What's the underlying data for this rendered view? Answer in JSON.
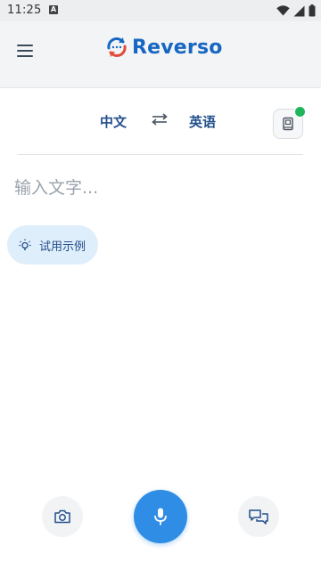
{
  "status_bar": {
    "time": "11:25",
    "notification_icon": "a-notification-icon",
    "wifi_icon": "wifi-icon",
    "signal_icon": "cellular-signal-icon",
    "battery_icon": "battery-icon"
  },
  "app_bar": {
    "menu_icon": "hamburger-menu-icon",
    "logo_icon": "reverso-logo-icon",
    "logo_text": "Reverso",
    "brand_color": "#1767c2",
    "logo_accent": "#e24b3b"
  },
  "languages": {
    "source": "中文",
    "target": "英语",
    "swap_icon": "swap-arrows-icon",
    "dictionary_icon": "book-icon",
    "indicator_color": "#1fb55a"
  },
  "input": {
    "placeholder": "输入文字...",
    "value": ""
  },
  "try_example": {
    "label": "试用示例",
    "icon": "lightbulb-icon"
  },
  "bottom_actions": {
    "camera_icon": "camera-icon",
    "mic_icon": "microphone-icon",
    "conversation_icon": "chat-bubbles-icon",
    "mic_color": "#2f8de6"
  }
}
